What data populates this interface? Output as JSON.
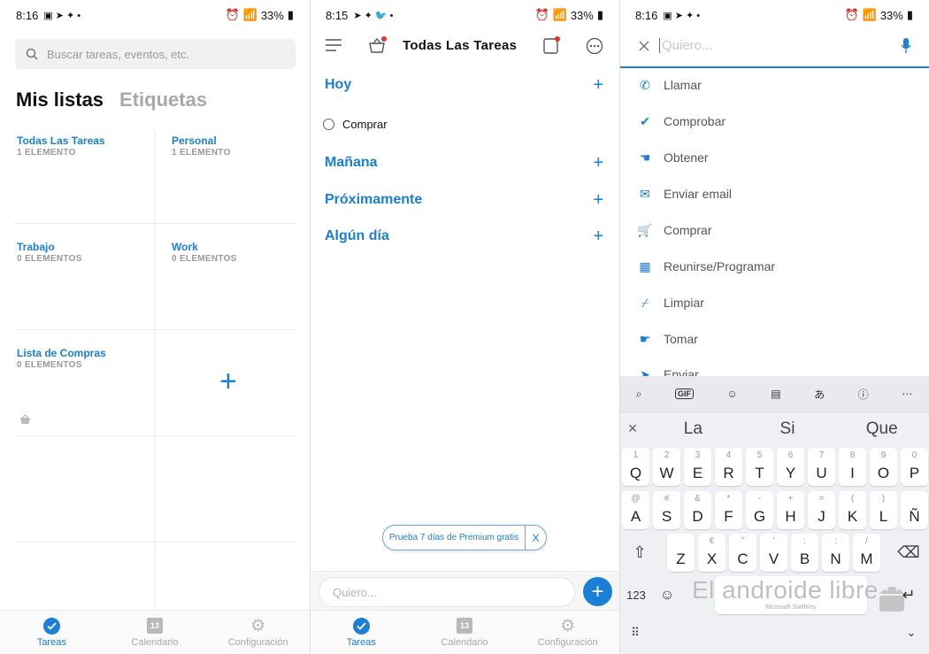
{
  "screen1": {
    "status": {
      "time": "8:16",
      "battery": "33%"
    },
    "search_placeholder": "Buscar tareas, eventos, etc.",
    "tabs": [
      "Mis listas",
      "Etiquetas"
    ],
    "lists": [
      {
        "title": "Todas Las Tareas",
        "count": "1 ELEMENTO"
      },
      {
        "title": "Personal",
        "count": "1 ELEMENTO"
      },
      {
        "title": "Trabajo",
        "count": "0 ELEMENTOS"
      },
      {
        "title": "Work",
        "count": "0 ELEMENTOS"
      },
      {
        "title": "Lista de Compras",
        "count": "0 ELEMENTOS"
      }
    ],
    "nav": [
      "Tareas",
      "Calendario",
      "Configuración"
    ]
  },
  "screen2": {
    "status": {
      "time": "8:15",
      "battery": "33%"
    },
    "title": "Todas Las Tareas",
    "sections": [
      "Hoy",
      "Mañana",
      "Próximamente",
      "Algún día"
    ],
    "task": "Comprar",
    "promo": "Prueba 7 días de Premium gratis",
    "promo_close": "X",
    "input_placeholder": "Quiero...",
    "nav": [
      "Tareas",
      "Calendario",
      "Configuración"
    ]
  },
  "screen3": {
    "status": {
      "time": "8:16",
      "battery": "33%"
    },
    "placeholder": "Quiero...",
    "suggestions": [
      "Llamar",
      "Comprobar",
      "Obtener",
      "Enviar email",
      "Comprar",
      "Reunirse/Programar",
      "Limpiar",
      "Tomar",
      "Enviar"
    ],
    "keyboard": {
      "tool_gif": "GIF",
      "word_suggestions": [
        "La",
        "Si",
        "Que"
      ],
      "row1": [
        [
          "1",
          "Q"
        ],
        [
          "2",
          "W"
        ],
        [
          "3",
          "E"
        ],
        [
          "4",
          "R"
        ],
        [
          "5",
          "T"
        ],
        [
          "6",
          "Y"
        ],
        [
          "7",
          "U"
        ],
        [
          "8",
          "I"
        ],
        [
          "9",
          "O"
        ],
        [
          "0",
          "P"
        ]
      ],
      "row2": [
        [
          "@",
          "A"
        ],
        [
          "#",
          "S"
        ],
        [
          "&",
          "D"
        ],
        [
          "*",
          "F"
        ],
        [
          "-",
          "G"
        ],
        [
          "+",
          "H"
        ],
        [
          "=",
          "J"
        ],
        [
          "(",
          "K"
        ],
        [
          ")",
          "L"
        ],
        [
          "",
          "Ñ"
        ]
      ],
      "row3": [
        [
          "",
          "Z"
        ],
        [
          "€",
          "X"
        ],
        [
          "\"",
          "C"
        ],
        [
          "'",
          "V"
        ],
        [
          ":",
          "B"
        ],
        [
          ";",
          "N"
        ],
        [
          "/",
          "M"
        ]
      ],
      "num_label": "123",
      "brand": "Microsoft SwiftKey",
      "watermark": "El androide libre"
    }
  }
}
